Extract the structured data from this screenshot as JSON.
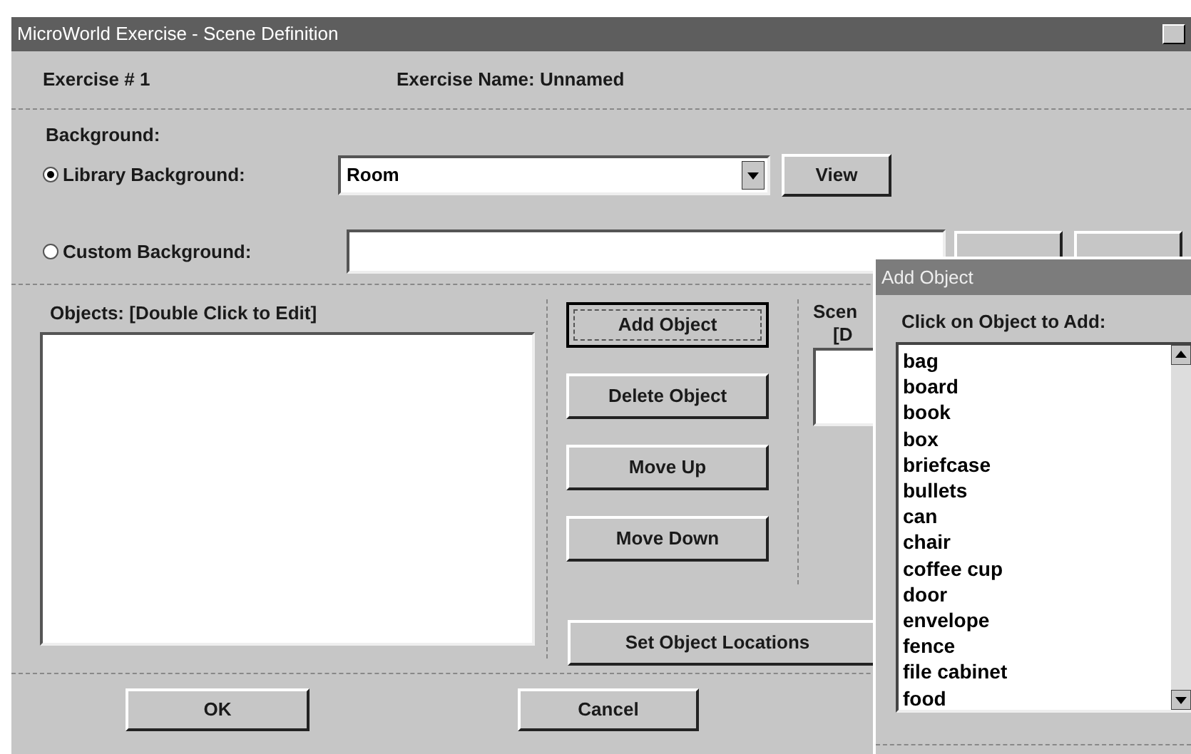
{
  "window": {
    "title": "MicroWorld Exercise - Scene Definition"
  },
  "exercise_number": {
    "label": "Exercise #",
    "value": "1"
  },
  "exercise_name": {
    "label": "Exercise Name:",
    "value": "Unnamed"
  },
  "background": {
    "label": "Background:",
    "options": [
      {
        "label": "Library Background:",
        "selected": true,
        "value": "Room",
        "kind": "combo"
      },
      {
        "label": "Custom Background:",
        "selected": false,
        "kind": "text"
      }
    ]
  },
  "view_button": "View",
  "objects": {
    "label": "Objects: [Double Click to Edit]"
  },
  "object_buttons": [
    {
      "label": "Add Object",
      "focused": true
    },
    {
      "label": "Delete Object",
      "focused": false
    },
    {
      "label": "Move Up",
      "focused": false
    },
    {
      "label": "Move Down",
      "focused": false
    }
  ],
  "scene_label": [
    "Scen",
    "[D"
  ],
  "set_locations_button": "Set Object Locations",
  "footer_buttons": [
    "OK",
    "Cancel"
  ],
  "add_object_dialog": {
    "title": "Add Object",
    "label": "Click on Object to Add:",
    "items": [
      "bag",
      "board",
      "book",
      "box",
      "briefcase",
      "bullets",
      "can",
      "chair",
      "coffee cup",
      "door",
      "envelope",
      "fence",
      "file cabinet",
      "food"
    ]
  }
}
